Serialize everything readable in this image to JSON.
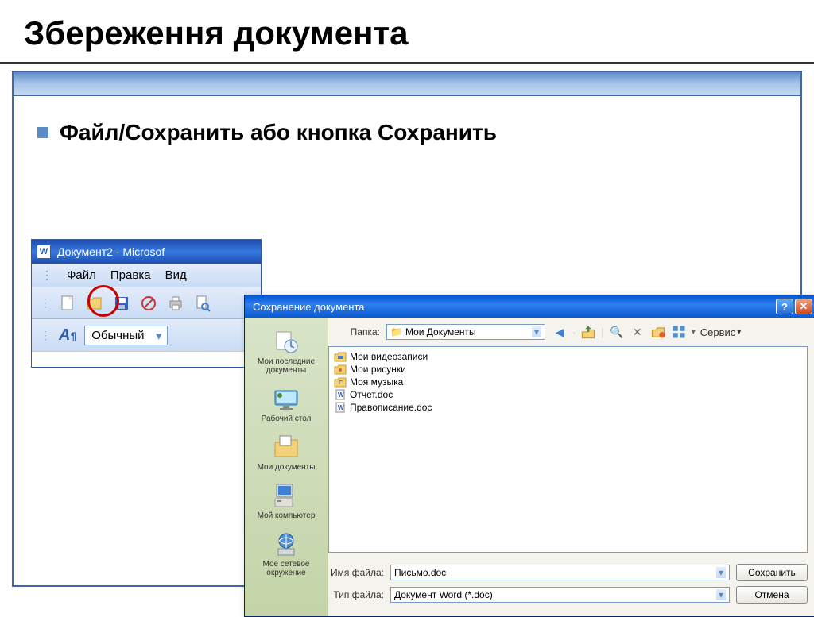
{
  "slide": {
    "title": "Збереження документа",
    "bullet": "Файл/Сохранить  або кнопка Сохранить"
  },
  "word": {
    "title": "Документ2 - Microsof",
    "menu": {
      "file": "Файл",
      "edit": "Правка",
      "view": "Вид"
    },
    "style_label": "Обычный"
  },
  "dialog": {
    "title": "Сохранение документа",
    "folder_label": "Папка:",
    "folder_value": "Мои Документы",
    "tools_label": "Сервис",
    "sidebar": [
      {
        "label": "Мои последние документы"
      },
      {
        "label": "Рабочий стол"
      },
      {
        "label": "Мои документы"
      },
      {
        "label": "Мой компьютер"
      },
      {
        "label": "Мое сетевое окружение"
      }
    ],
    "files": [
      {
        "name": "Мои видеозаписи",
        "type": "folder"
      },
      {
        "name": "Мои рисунки",
        "type": "folder"
      },
      {
        "name": "Моя музыка",
        "type": "folder"
      },
      {
        "name": "Отчет.doc",
        "type": "doc"
      },
      {
        "name": "Правописание.doc",
        "type": "doc"
      }
    ],
    "filename_label": "Имя файла:",
    "filename_value": "Письмо.doc",
    "filetype_label": "Тип файла:",
    "filetype_value": "Документ Word (*.doc)",
    "save_btn": "Сохранить",
    "cancel_btn": "Отмена"
  }
}
